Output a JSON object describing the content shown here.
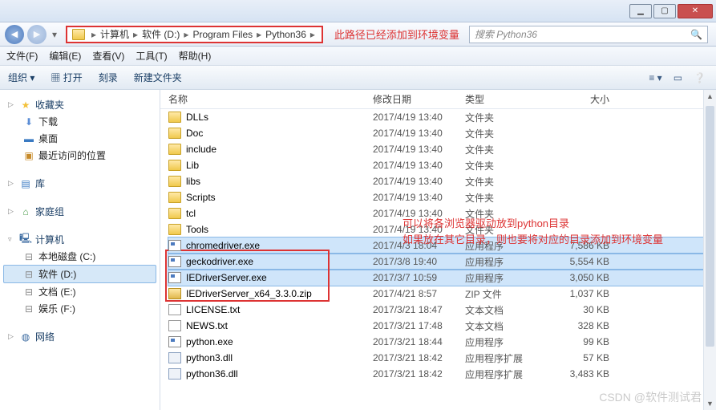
{
  "window_buttons": {
    "min": "▁",
    "max": "▢",
    "close": "✕"
  },
  "breadcrumb": [
    "计算机",
    "软件 (D:)",
    "Program Files",
    "Python36"
  ],
  "breadcrumb_arrow": "▸",
  "annotation_path": "此路径已经添加到环境变量",
  "search_placeholder": "搜索 Python36",
  "menubar": {
    "file": "文件(F)",
    "edit": "编辑(E)",
    "view": "查看(V)",
    "tools": "工具(T)",
    "help": "帮助(H)"
  },
  "toolbar": {
    "organize": "组织 ▾",
    "open": "打开",
    "burn": "刻录",
    "newfolder": "新建文件夹"
  },
  "sidebar": {
    "favorites": {
      "label": "收藏夹",
      "items": [
        {
          "icon": "dl",
          "label": "下载"
        },
        {
          "icon": "desktop",
          "label": "桌面"
        },
        {
          "icon": "recent",
          "label": "最近访问的位置"
        }
      ]
    },
    "libraries": {
      "label": "库"
    },
    "homegroup": {
      "label": "家庭组"
    },
    "computer": {
      "label": "计算机",
      "items": [
        {
          "icon": "disk",
          "label": "本地磁盘 (C:)"
        },
        {
          "icon": "disk",
          "label": "软件 (D:)",
          "selected": true
        },
        {
          "icon": "disk",
          "label": "文档 (E:)"
        },
        {
          "icon": "disk",
          "label": "娱乐 (F:)"
        }
      ]
    },
    "network": {
      "label": "网络"
    }
  },
  "columns": {
    "name": "名称",
    "date": "修改日期",
    "type": "类型",
    "size": "大小"
  },
  "files": [
    {
      "icon": "folder",
      "name": "DLLs",
      "date": "2017/4/19 13:40",
      "type": "文件夹",
      "size": ""
    },
    {
      "icon": "folder",
      "name": "Doc",
      "date": "2017/4/19 13:40",
      "type": "文件夹",
      "size": ""
    },
    {
      "icon": "folder",
      "name": "include",
      "date": "2017/4/19 13:40",
      "type": "文件夹",
      "size": ""
    },
    {
      "icon": "folder",
      "name": "Lib",
      "date": "2017/4/19 13:40",
      "type": "文件夹",
      "size": ""
    },
    {
      "icon": "folder",
      "name": "libs",
      "date": "2017/4/19 13:40",
      "type": "文件夹",
      "size": ""
    },
    {
      "icon": "folder",
      "name": "Scripts",
      "date": "2017/4/19 13:40",
      "type": "文件夹",
      "size": ""
    },
    {
      "icon": "folder",
      "name": "tcl",
      "date": "2017/4/19 13:40",
      "type": "文件夹",
      "size": ""
    },
    {
      "icon": "folder",
      "name": "Tools",
      "date": "2017/4/19 13:40",
      "type": "文件夹",
      "size": ""
    },
    {
      "icon": "exe",
      "name": "chromedriver.exe",
      "date": "2017/4/3 18:04",
      "type": "应用程序",
      "size": "7,586 KB",
      "selected": true
    },
    {
      "icon": "exe",
      "name": "geckodriver.exe",
      "date": "2017/3/8 19:40",
      "type": "应用程序",
      "size": "5,554 KB",
      "selected": true
    },
    {
      "icon": "exe",
      "name": "IEDriverServer.exe",
      "date": "2017/3/7 10:59",
      "type": "应用程序",
      "size": "3,050 KB",
      "selected": true
    },
    {
      "icon": "zip",
      "name": "IEDriverServer_x64_3.3.0.zip",
      "date": "2017/4/21 8:57",
      "type": "ZIP 文件",
      "size": "1,037 KB"
    },
    {
      "icon": "txt",
      "name": "LICENSE.txt",
      "date": "2017/3/21 18:47",
      "type": "文本文档",
      "size": "30 KB"
    },
    {
      "icon": "txt",
      "name": "NEWS.txt",
      "date": "2017/3/21 17:48",
      "type": "文本文档",
      "size": "328 KB"
    },
    {
      "icon": "exe",
      "name": "python.exe",
      "date": "2017/3/21 18:44",
      "type": "应用程序",
      "size": "99 KB"
    },
    {
      "icon": "dll",
      "name": "python3.dll",
      "date": "2017/3/21 18:42",
      "type": "应用程序扩展",
      "size": "57 KB"
    },
    {
      "icon": "dll",
      "name": "python36.dll",
      "date": "2017/3/21 18:42",
      "type": "应用程序扩展",
      "size": "3,483 KB"
    }
  ],
  "annotations": {
    "line1": "可以将各浏览器驱动放到python目录",
    "line2": "如果放在其它目录，则也要将对应的目录添加到环境变量"
  },
  "watermark": "CSDN @软件测试君"
}
